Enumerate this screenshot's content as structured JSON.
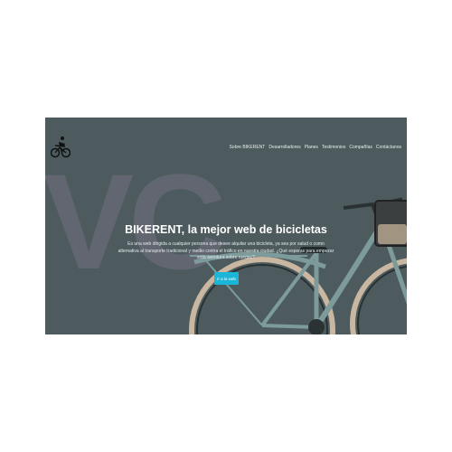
{
  "nav": {
    "items": [
      "Sobre BIKERENT",
      "Desarrolladores",
      "Planes",
      "Testimonios",
      "Compañías",
      "Contáctanos"
    ]
  },
  "hero": {
    "background_letters": "VC",
    "title": "BIKERENT, la mejor web de bicicletas",
    "description": "Es una web dirigida a cualquier persona que desee alquilar una bicicleta, ya sea por salud o como alternativa al transporte tradicional y medio contra el tráfico en nuestra ciudad. ¿Qué esperas para empezar esta aventura sobre ruedas?",
    "cta_label": "Ir a la web"
  },
  "colors": {
    "hero_bg": "#4d5b5e",
    "accent": "#19b6d8",
    "bike_frame": "#7d9b9b"
  },
  "icons": {
    "logo": "bicycle-rider-icon",
    "background_image": "bicycle-photo"
  }
}
